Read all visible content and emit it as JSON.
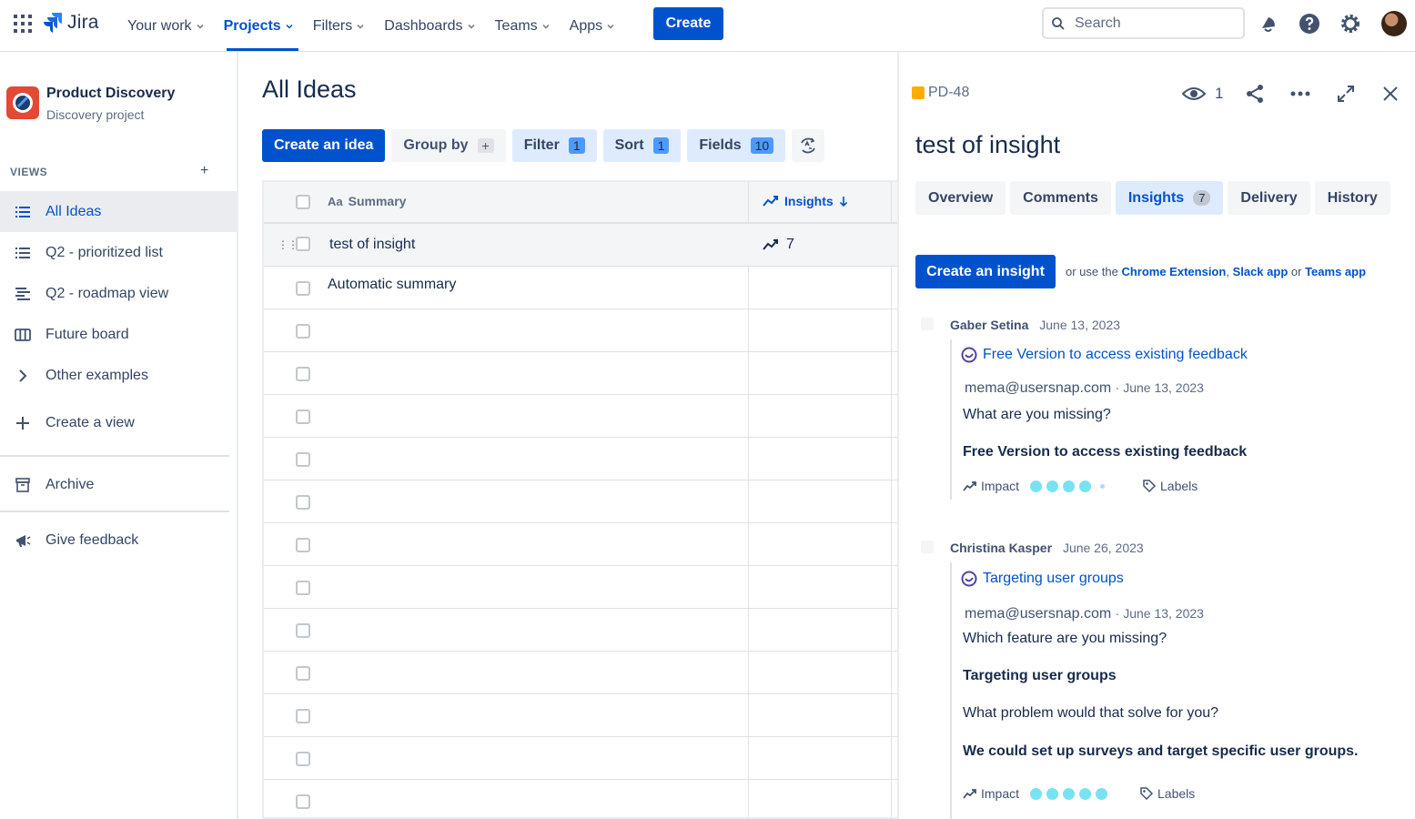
{
  "topnav": {
    "app_name": "Jira",
    "items": [
      {
        "label": "Your work"
      },
      {
        "label": "Projects"
      },
      {
        "label": "Filters"
      },
      {
        "label": "Dashboards"
      },
      {
        "label": "Teams"
      },
      {
        "label": "Apps"
      }
    ],
    "create_label": "Create",
    "search_placeholder": "Search",
    "accent": "#0052CC"
  },
  "sidebar": {
    "project_name": "Product Discovery",
    "project_type": "Discovery project",
    "views_label": "VIEWS",
    "views_add": "+",
    "items": [
      {
        "label": "All Ideas",
        "icon": "list-icon"
      },
      {
        "label": "Q2 - prioritized list",
        "icon": "list-icon"
      },
      {
        "label": "Q2 - roadmap view",
        "icon": "timeline-icon"
      },
      {
        "label": "Future board",
        "icon": "board-icon"
      },
      {
        "label": "Other examples",
        "icon": "chevron-right-icon"
      },
      {
        "label": "Create a view",
        "icon": "plus-icon"
      }
    ],
    "archive_label": "Archive",
    "feedback_label": "Give feedback"
  },
  "main": {
    "title": "All Ideas",
    "toolbar": {
      "create_idea": "Create an idea",
      "group_by": "Group by",
      "group_by_plus": "+",
      "filter": "Filter",
      "filter_count": "1",
      "sort": "Sort",
      "sort_count": "1",
      "fields": "Fields",
      "fields_count": "10"
    },
    "columns": {
      "summary_prefix": "Aa",
      "summary": "Summary",
      "insights": "Insights"
    },
    "rows": [
      {
        "summary": "test of insight",
        "insights": "7"
      },
      {
        "summary": "Automatic summary",
        "insights": ""
      }
    ]
  },
  "panel": {
    "key": "PD-48",
    "watchers": "1",
    "title": "test of insight",
    "tabs": [
      {
        "label": "Overview"
      },
      {
        "label": "Comments"
      },
      {
        "label": "Insights",
        "count": "7"
      },
      {
        "label": "Delivery"
      },
      {
        "label": "History"
      }
    ],
    "create_insight": "Create an insight",
    "use_prefix": "or use the",
    "chrome_ext": "Chrome Extension",
    "comma": ",",
    "slack_app": "Slack app",
    "or": "or",
    "teams_app": "Teams app",
    "insights": [
      {
        "author": "Gaber Setina",
        "date": "June 13, 2023",
        "link": "Free Version to access existing feedback",
        "source": "mema@usersnap.com",
        "source_date": "· June 13, 2023",
        "lines": [
          {
            "text": "What are you missing?",
            "bold": false
          },
          {
            "text": "Free Version to access existing feedback",
            "bold": true
          }
        ],
        "impact_label": "Impact",
        "impact": 4,
        "labels_label": "Labels"
      },
      {
        "author": "Christina Kasper",
        "date": "June 26, 2023",
        "link": "Targeting user groups",
        "source": "mema@usersnap.com",
        "source_date": "· June 13, 2023",
        "lines": [
          {
            "text": "Which feature are you missing?",
            "bold": false
          },
          {
            "text": "Targeting user groups",
            "bold": true
          },
          {
            "text": "What problem would that solve for you?",
            "bold": false
          },
          {
            "text": "We could set up surveys and target specific user groups.",
            "bold": true
          }
        ],
        "impact_label": "Impact",
        "impact": 5,
        "labels_label": "Labels"
      }
    ]
  }
}
